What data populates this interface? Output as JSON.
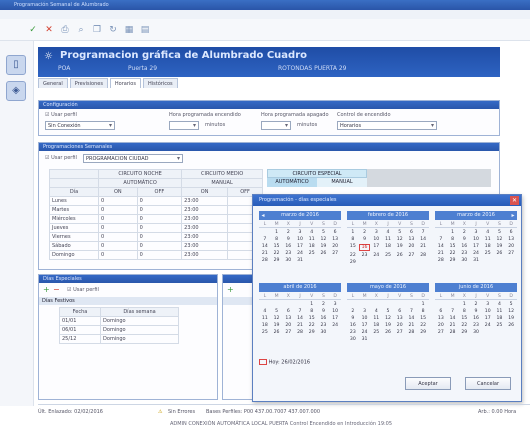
{
  "window": {
    "title": "Programación Semanal de Alumbrado"
  },
  "menu": "",
  "header": {
    "title": "Programacion gráfica de Alumbrado Cuadro",
    "sub_left": "POA",
    "sub_mid": "Puerta 29",
    "sub_right": "ROTONDAS PUERTA 29"
  },
  "tabs": [
    "General",
    "Previsiones",
    "Horarios",
    "Históricos"
  ],
  "config": {
    "bar": "Configuración",
    "check1": "Usar perfil",
    "combo1": "Sin Conexión",
    "lbl_prog": "Hora programada encendido",
    "lbl_apag": "Hora programada apagado",
    "lbl_ctrl": "Control de encendido",
    "val_min": "minutos",
    "val_ctrl": "Horarios"
  },
  "prog": {
    "bar": "Programaciones Semanales",
    "check": "Usar perfil",
    "combo": "PROGRAMACION CIUDAD",
    "groups": [
      "CIRCUITO NOCHE",
      "CIRCUITO MEDIO",
      "CIRCUITO ESPECIAL"
    ],
    "subgroups": [
      "AUTOMÁTICO",
      "MANUAL",
      "AUTOMÁTICO",
      "MANUAL"
    ],
    "cols": [
      "Día",
      "ON",
      "OFF",
      "ON",
      "OFF",
      "ON",
      "OFF"
    ],
    "rows": [
      [
        "Lunes",
        "0",
        "0",
        "23:00"
      ],
      [
        "Martes",
        "0",
        "0",
        "23:00"
      ],
      [
        "Miércoles",
        "0",
        "0",
        "23:00"
      ],
      [
        "Jueves",
        "0",
        "0",
        "23:00"
      ],
      [
        "Viernes",
        "0",
        "0",
        "23:00"
      ],
      [
        "Sábado",
        "0",
        "0",
        "23:00"
      ],
      [
        "Domingo",
        "0",
        "0",
        "23:00"
      ]
    ]
  },
  "festivos": {
    "bar": "Días Especiales",
    "check": "Usar perfil",
    "label": "Días Festivos",
    "cols": [
      "Fecha",
      "Días semana"
    ],
    "rows": [
      [
        "01/01",
        "Domingo"
      ],
      [
        "06/01",
        "Domingo"
      ],
      [
        "25/12",
        "Domingo"
      ]
    ]
  },
  "calendar": {
    "title": "Programación - días especiales",
    "weekdays": [
      "L",
      "M",
      "X",
      "J",
      "V",
      "S",
      "D"
    ],
    "months": [
      {
        "name": "marzo de 2016",
        "start": 1,
        "days": 31
      },
      {
        "name": "febrero de 2016",
        "start": 0,
        "days": 29,
        "selected": 16
      },
      {
        "name": "marzo de 2016",
        "start": 1,
        "days": 31
      },
      {
        "name": "abril de 2016",
        "start": 4,
        "days": 30
      },
      {
        "name": "mayo de 2016",
        "start": 6,
        "days": 31
      },
      {
        "name": "junio de 2016",
        "start": 2,
        "days": 30
      }
    ],
    "today": "Hoy: 26/02/2016",
    "ok": "Aceptar",
    "cancel": "Cancelar"
  },
  "status": {
    "left": "Últ. Enlazado: 02/02/2016",
    "mid": "Sin Errores",
    "readings": "Bases Perfiles: P00  437.00.7007  437.007.000",
    "right": "Arb.: 0.00   Hora",
    "line2": "ADMIN   CONEXIÓN AUTOMÁTICA LOCAL PUERTA   Control Encendido en Introducción 19:05"
  }
}
